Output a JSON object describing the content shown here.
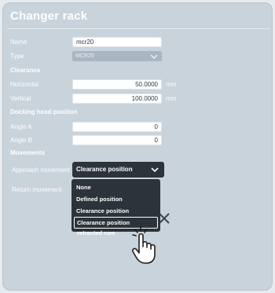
{
  "window": {
    "title": "Changer rack"
  },
  "form": {
    "name": {
      "label": "Name",
      "value": "mcr20"
    },
    "type": {
      "label": "Type",
      "value": "MCR20"
    },
    "clearance": {
      "section": "Clearance",
      "horizontal": {
        "label": "Horizontal",
        "value": "50.0000",
        "unit": "mm"
      },
      "vertical": {
        "label": "Vertical",
        "value": "100.0000",
        "unit": "mm"
      }
    },
    "docking": {
      "section": "Docking head position",
      "angle_a": {
        "label": "Angle A",
        "value": "0"
      },
      "angle_b": {
        "label": "Angle B",
        "value": "0"
      }
    },
    "movements": {
      "section": "Movements",
      "approach": {
        "label": "Approach movement",
        "value": "Clearance position"
      },
      "return": {
        "label": "Return movement"
      }
    }
  },
  "dropdown": {
    "options": [
      "None",
      "Defined position",
      "Clearance position",
      "Clearance position retracted rum"
    ],
    "highlighted_index": 3
  },
  "icons": {
    "confirm": "check-icon",
    "cancel": "close-icon",
    "cursor": "hand-pointer-icon"
  },
  "colors": {
    "panel": "#c8d3dc",
    "active_combo": "#2c333a",
    "disabled_combo": "#a8b6c2"
  }
}
